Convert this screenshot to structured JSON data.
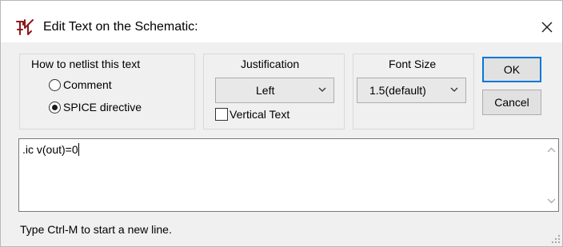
{
  "window": {
    "title": "Edit Text on the Schematic:",
    "app_icon": "ltspice-icon",
    "close_icon": "close-icon"
  },
  "netlist_group": {
    "title": "How to netlist this text",
    "options": [
      {
        "label": "Comment",
        "checked": false
      },
      {
        "label": "SPICE directive",
        "checked": true
      }
    ]
  },
  "justification_group": {
    "title": "Justification",
    "selected": "Left",
    "vertical_text_label": "Vertical Text",
    "vertical_text_checked": false
  },
  "font_size_group": {
    "title": "Font Size",
    "selected": "1.5(default)"
  },
  "buttons": {
    "ok": "OK",
    "cancel": "Cancel"
  },
  "editor": {
    "value": ".ic v(out)=0"
  },
  "status": {
    "hint": "Type Ctrl-M to start a new line."
  },
  "colors": {
    "dialog_bg": "#f0f0f0",
    "default_button_border": "#0078d7",
    "icon_red": "#8b1a1a"
  }
}
